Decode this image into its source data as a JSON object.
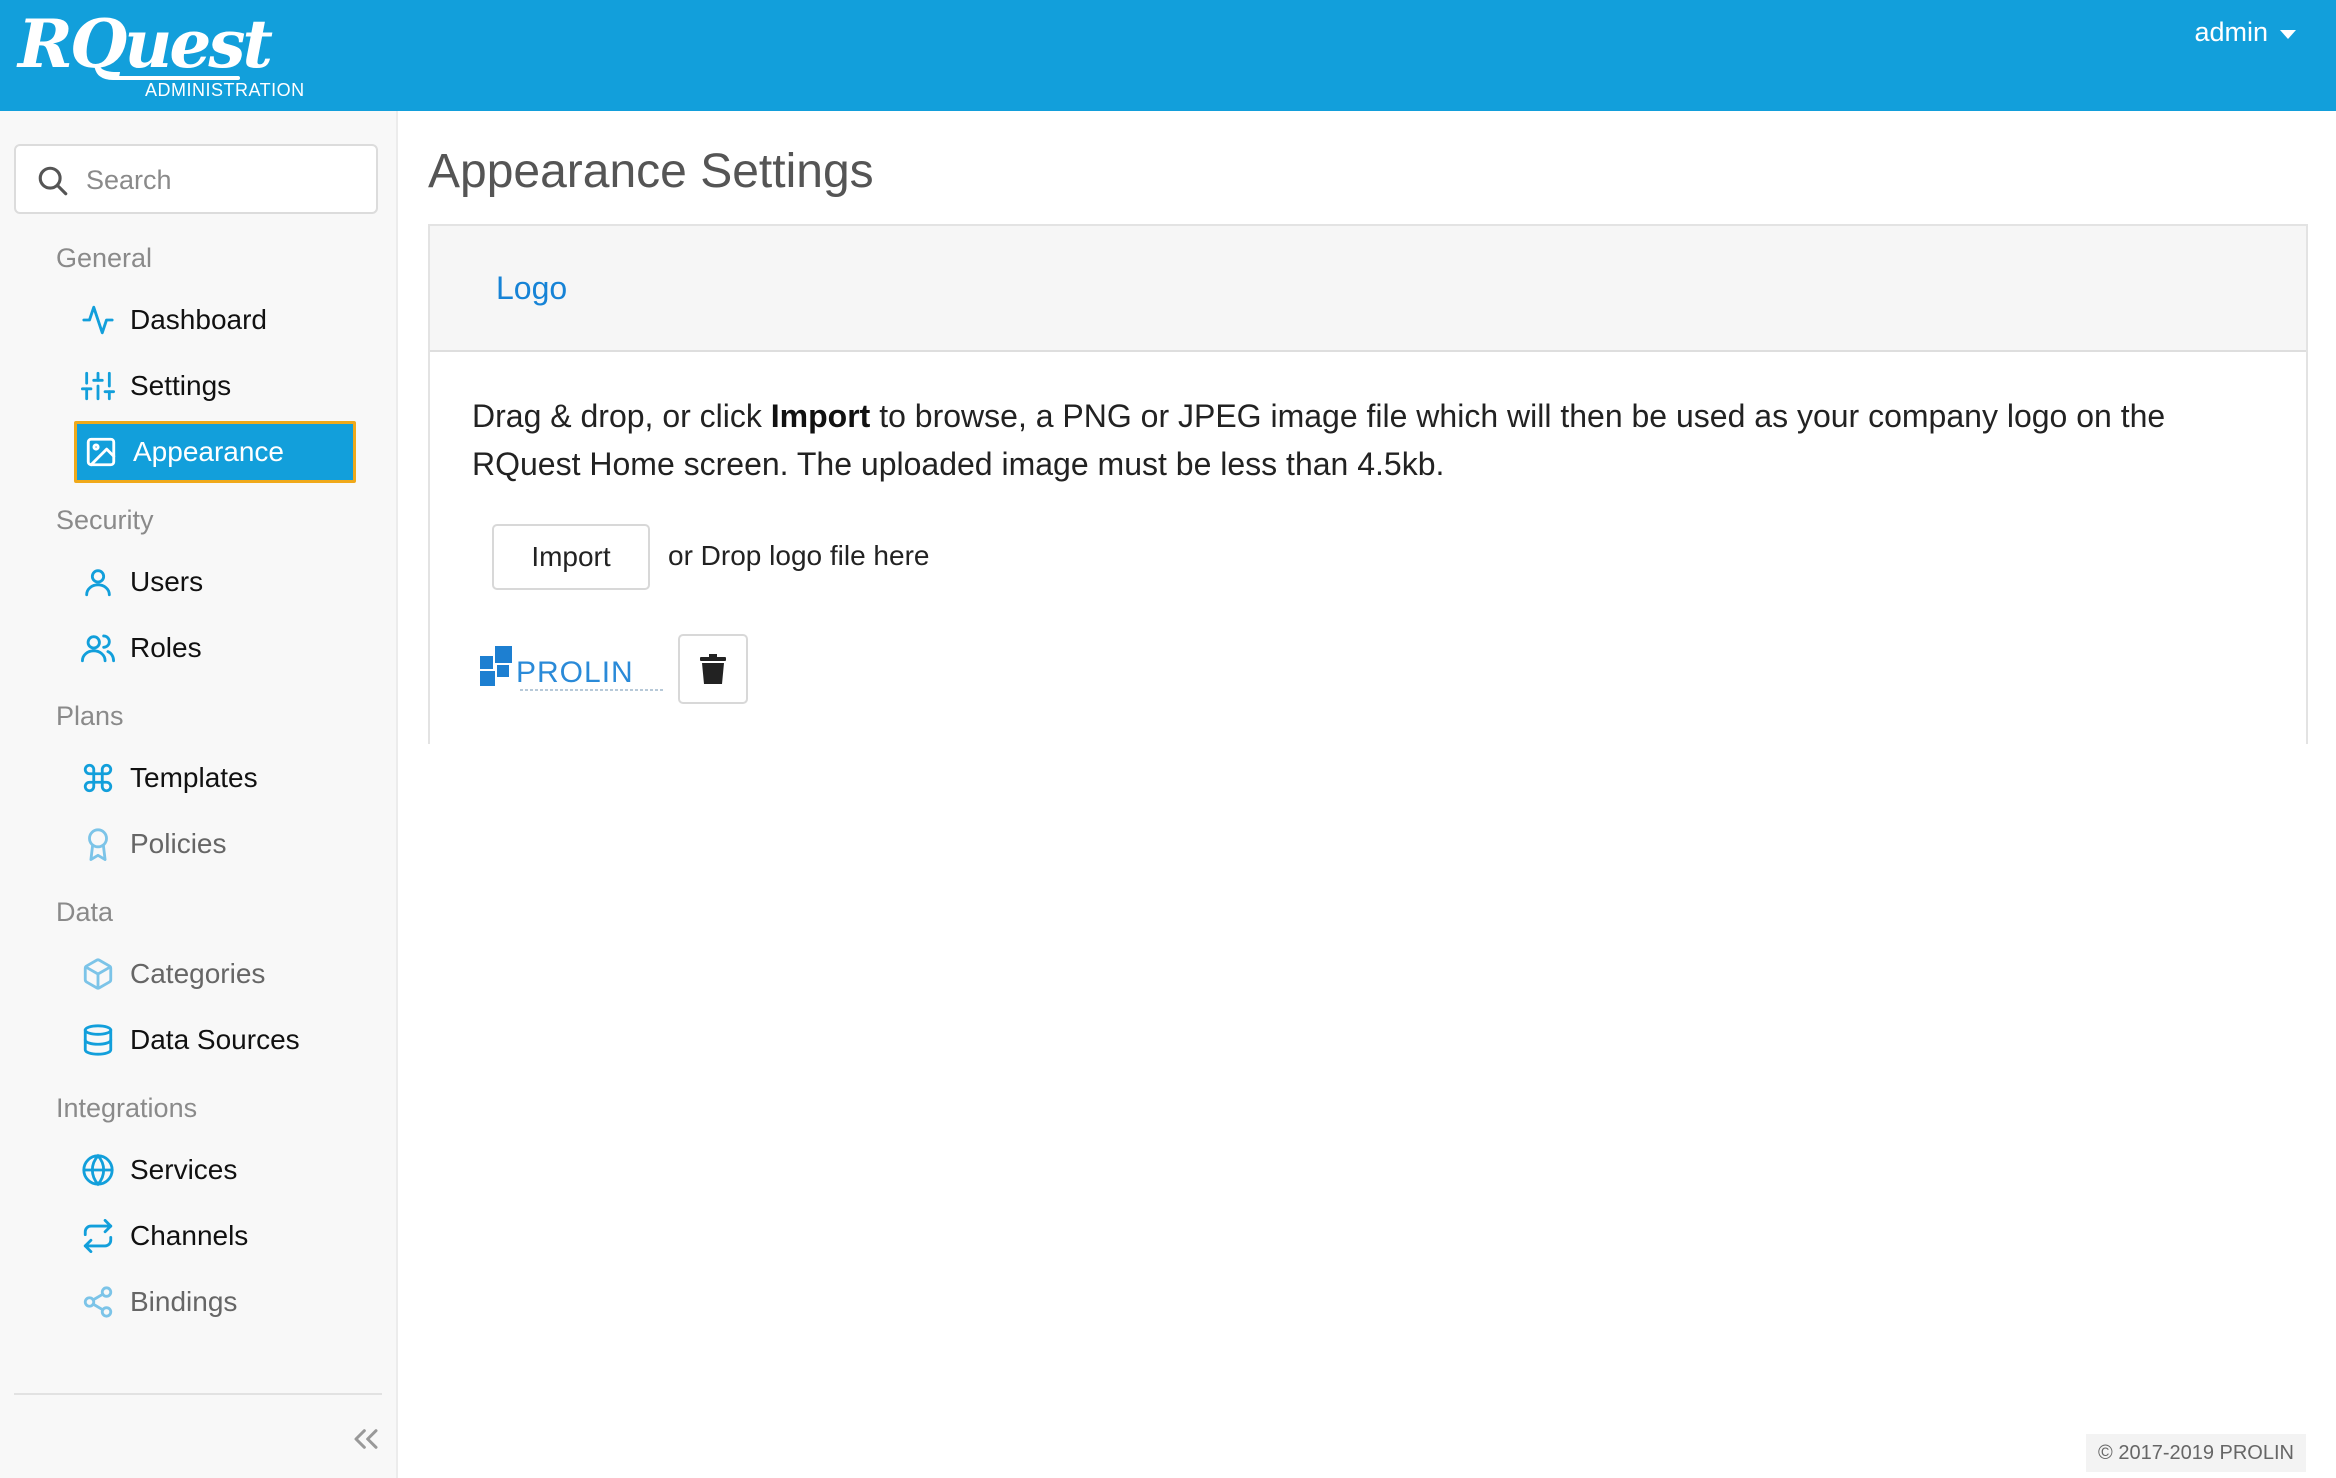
{
  "header": {
    "brand_name": "RQuest",
    "brand_subtitle": "ADMINISTRATION",
    "user_label": "admin",
    "background_color": "#129fdb"
  },
  "sidebar": {
    "search_placeholder": "Search",
    "sections": [
      {
        "title": "General",
        "items": [
          {
            "label": "Dashboard",
            "icon": "activity-icon"
          },
          {
            "label": "Settings",
            "icon": "sliders-icon"
          },
          {
            "label": "Appearance",
            "icon": "image-icon",
            "active": true
          }
        ]
      },
      {
        "title": "Security",
        "items": [
          {
            "label": "Users",
            "icon": "user-icon"
          },
          {
            "label": "Roles",
            "icon": "users-icon"
          }
        ]
      },
      {
        "title": "Plans",
        "items": [
          {
            "label": "Templates",
            "icon": "command-icon"
          },
          {
            "label": "Policies",
            "icon": "award-icon"
          }
        ]
      },
      {
        "title": "Data",
        "items": [
          {
            "label": "Categories",
            "icon": "box-icon"
          },
          {
            "label": "Data Sources",
            "icon": "database-icon"
          }
        ]
      },
      {
        "title": "Integrations",
        "items": [
          {
            "label": "Services",
            "icon": "globe-icon"
          },
          {
            "label": "Channels",
            "icon": "repeat-icon"
          },
          {
            "label": "Bindings",
            "icon": "share-icon"
          }
        ]
      }
    ],
    "active_color": "#129fdb",
    "active_border_color": "#f0a91a"
  },
  "main": {
    "title": "Appearance Settings",
    "panel": {
      "tab_label": "Logo",
      "description_prefix": "Drag & drop, or click ",
      "description_bold": "Import",
      "description_suffix": " to browse, a PNG or JPEG image file which will then be used as your company logo on the RQuest Home screen. The uploaded image must be less than 4.5kb.",
      "import_label": "Import",
      "drop_hint": "or Drop logo file here",
      "logo_text": "PROLIN"
    }
  },
  "footer": {
    "copyright": "© 2017-2019 PROLIN"
  }
}
